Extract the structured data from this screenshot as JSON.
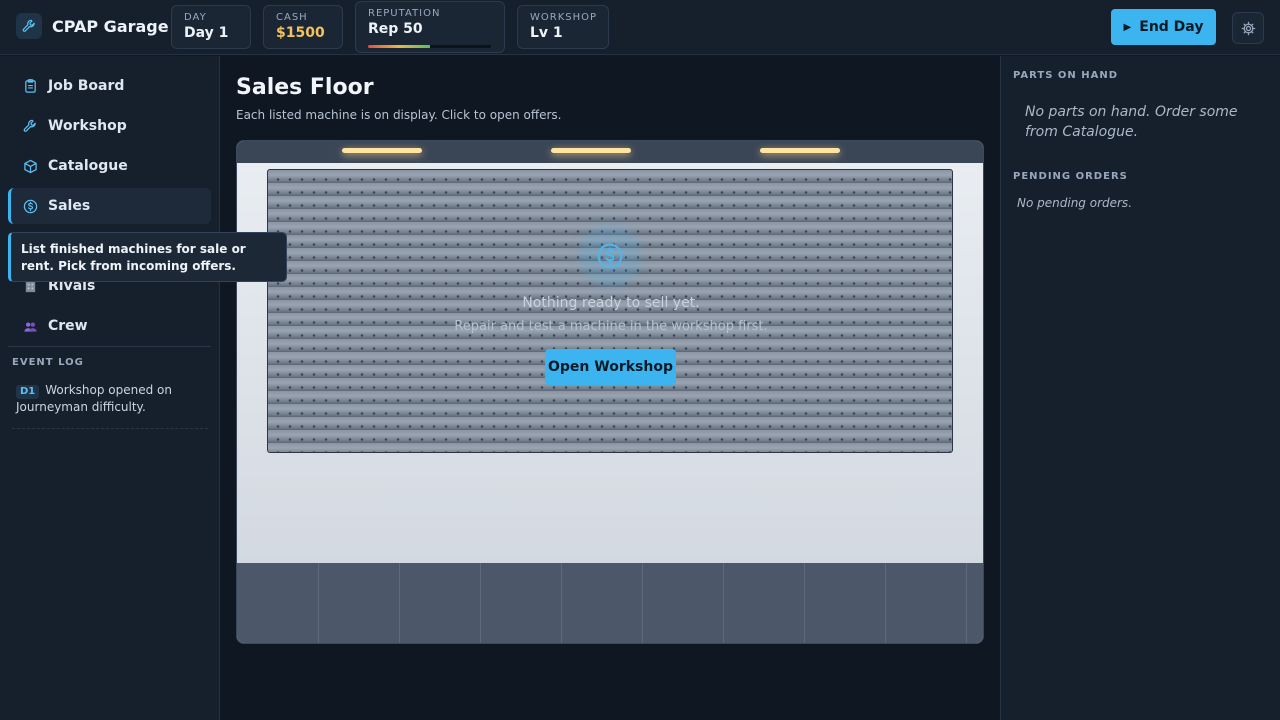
{
  "app": {
    "title": "CPAP Garage",
    "icon": "wrench-icon"
  },
  "stats": {
    "day": {
      "label": "DAY",
      "value": "Day 1"
    },
    "cash": {
      "label": "CASH",
      "value": "$1500"
    },
    "reputation": {
      "label": "REPUTATION",
      "value": "Rep 50",
      "level": 0.5
    },
    "workshop": {
      "label": "WORKSHOP",
      "value": "Lv 1"
    }
  },
  "toolbar": {
    "end_day_label": "End Day",
    "settings_icon": "gear-icon"
  },
  "sidebar": {
    "items": [
      {
        "label": "Job Board",
        "icon": "clipboard-icon"
      },
      {
        "label": "Workshop",
        "icon": "wrench-icon"
      },
      {
        "label": "Catalogue",
        "icon": "box-icon"
      },
      {
        "label": "Sales",
        "icon": "dollar-circle-icon",
        "active": true
      },
      {
        "label": "Rivals",
        "icon": "building-icon"
      },
      {
        "label": "Crew",
        "icon": "people-icon"
      }
    ],
    "tooltip": "List finished machines for sale or rent. Pick from incoming offers.",
    "event_log": {
      "title": "EVENT LOG",
      "entries": [
        {
          "badge": "D1",
          "text": "Workshop opened on Journeyman difficulty."
        }
      ]
    }
  },
  "main": {
    "title": "Sales Floor",
    "subtitle": "Each listed machine is on display. Click to open offers.",
    "empty_title": "Nothing ready to sell yet.",
    "empty_subtitle": "Repair and test a machine in the workshop first.",
    "open_workshop_label": "Open Workshop"
  },
  "right_panel": {
    "parts_title": "PARTS ON HAND",
    "parts_empty": "No parts on hand. Order some from Catalogue.",
    "orders_title": "PENDING ORDERS",
    "orders_empty": "No pending orders."
  },
  "colors": {
    "accent": "#3bb4f0",
    "cash": "#f3c25b",
    "background": "#0f1722",
    "panel": "#16202d"
  }
}
